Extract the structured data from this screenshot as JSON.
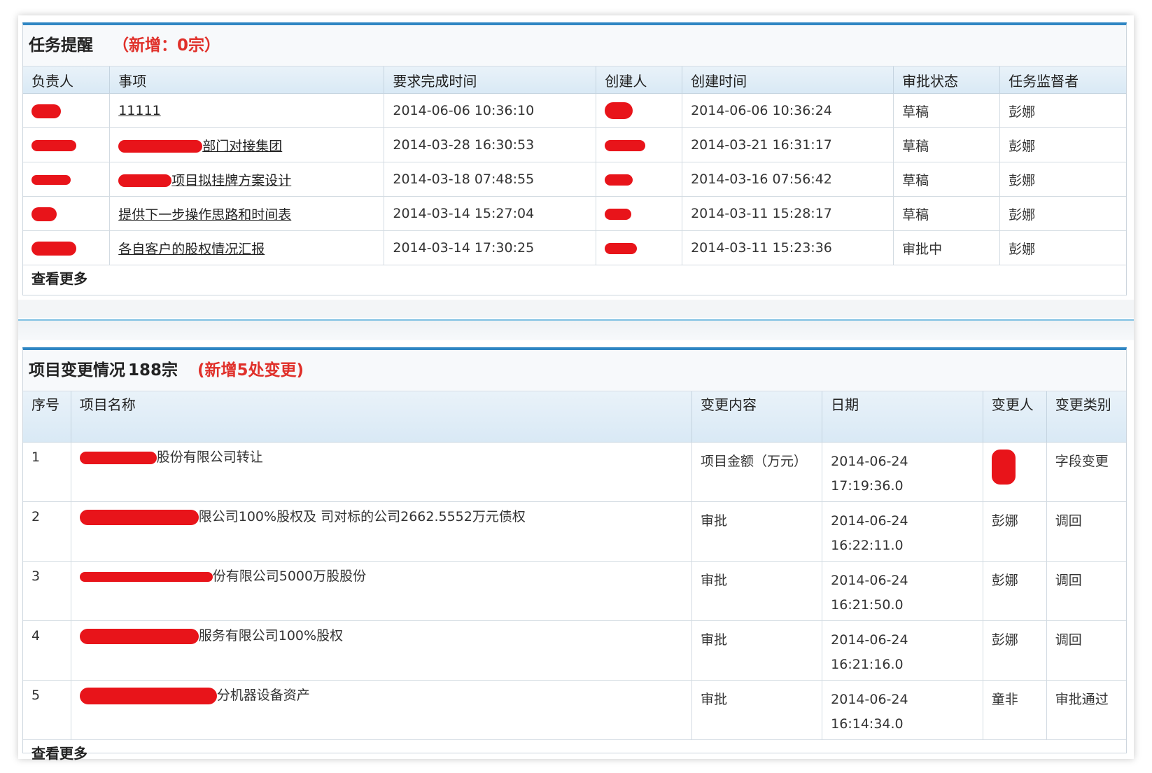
{
  "task_panel": {
    "title": "任务提醒",
    "new_note": "（新增：0宗）",
    "columns": [
      "负责人",
      "事项",
      "要求完成时间",
      "创建人",
      "创建时间",
      "审批状态",
      "任务监督者"
    ],
    "rows": [
      {
        "owner": "",
        "item": "11111",
        "due": "2014-06-06 10:36:10",
        "creator": "",
        "created": "2014-06-06 10:36:24",
        "status": "草稿",
        "supervisor": "彭娜"
      },
      {
        "owner": "",
        "item": "部门对接集团",
        "due": "2014-03-28 16:30:53",
        "creator": "",
        "created": "2014-03-21 16:31:17",
        "status": "草稿",
        "supervisor": "彭娜"
      },
      {
        "owner": "",
        "item": "项目拟挂牌方案设计",
        "due": "2014-03-18 07:48:55",
        "creator": "",
        "created": "2014-03-16 07:56:42",
        "status": "草稿",
        "supervisor": "彭娜"
      },
      {
        "owner": "",
        "item": "提供下一步操作思路和时间表",
        "due": "2014-03-14 15:27:04",
        "creator": "",
        "created": "2014-03-11 15:28:17",
        "status": "草稿",
        "supervisor": "彭娜"
      },
      {
        "owner": "",
        "item": "各自客户的股权情况汇报",
        "due": "2014-03-14 17:30:25",
        "creator": "",
        "created": "2014-03-11 15:23:36",
        "status": "审批中",
        "supervisor": "彭娜"
      }
    ],
    "more": "查看更多"
  },
  "change_panel": {
    "title": "项目变更情况",
    "count": "188宗",
    "new_note": "(新增5处变更)",
    "columns": [
      "序号",
      "项目名称",
      "变更内容",
      "日期",
      "变更人",
      "变更类别"
    ],
    "rows": [
      {
        "no": "1",
        "name": "股份有限公司转让",
        "content": "项目金额（万元）",
        "date": "2014-06-24 17:19:36.0",
        "person": "",
        "type": "字段变更"
      },
      {
        "no": "2",
        "name": "限公司100%股权及 司对标的公司2662.5552万元债权",
        "content": "审批",
        "date": "2014-06-24 16:22:11.0",
        "person": "彭娜",
        "type": "调回"
      },
      {
        "no": "3",
        "name": "份有限公司5000万股股份",
        "content": "审批",
        "date": "2014-06-24 16:21:50.0",
        "person": "彭娜",
        "type": "调回"
      },
      {
        "no": "4",
        "name": "服务有限公司100%股权",
        "content": "审批",
        "date": "2014-06-24 16:21:16.0",
        "person": "彭娜",
        "type": "调回"
      },
      {
        "no": "5",
        "name": "分机器设备资产",
        "content": "审批",
        "date": "2014-06-24 16:14:34.0",
        "person": "童非",
        "type": "审批通过"
      }
    ],
    "more": "查看更多"
  },
  "colors": {
    "accent_blue": "#2f86c3",
    "note_red": "#e0302a",
    "redaction_red": "#e8141a"
  }
}
